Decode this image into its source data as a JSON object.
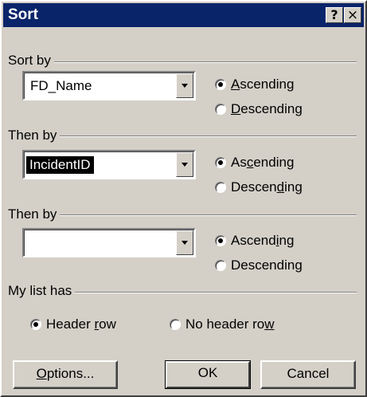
{
  "window": {
    "title": "Sort",
    "help_glyph": "?",
    "close_glyph": "×"
  },
  "sort_by": {
    "label": "Sort by",
    "field_value": "FD_Name",
    "ascending": {
      "pre": "",
      "mn": "A",
      "post": "scending",
      "checked": true
    },
    "descending": {
      "pre": "",
      "mn": "D",
      "post": "escending",
      "checked": false
    }
  },
  "then_by_1": {
    "label": "Then by",
    "field_value": "IncidentID",
    "ascending": {
      "pre": "As",
      "mn": "c",
      "post": "ending",
      "checked": true
    },
    "descending": {
      "pre": "Descen",
      "mn": "d",
      "post": "ing",
      "checked": false
    }
  },
  "then_by_2": {
    "label": "Then by",
    "field_value": "",
    "ascending": {
      "pre": "Ascend",
      "mn": "i",
      "post": "ng",
      "checked": true
    },
    "descending": {
      "pre": "Descendin",
      "mn": "g",
      "post": "",
      "checked": false
    }
  },
  "my_list_has": {
    "label": "My list has",
    "header_row": {
      "pre": "Header ",
      "mn": "r",
      "post": "ow",
      "checked": true
    },
    "no_header_row": {
      "pre": "No header ro",
      "mn": "w",
      "post": "",
      "checked": false
    }
  },
  "buttons": {
    "options": {
      "pre": "",
      "mn": "O",
      "post": "ptions..."
    },
    "ok": "OK",
    "cancel": "Cancel"
  },
  "colors": {
    "titlebar": "#0a246a",
    "face": "#d4d0c8",
    "selection": "#000000"
  }
}
